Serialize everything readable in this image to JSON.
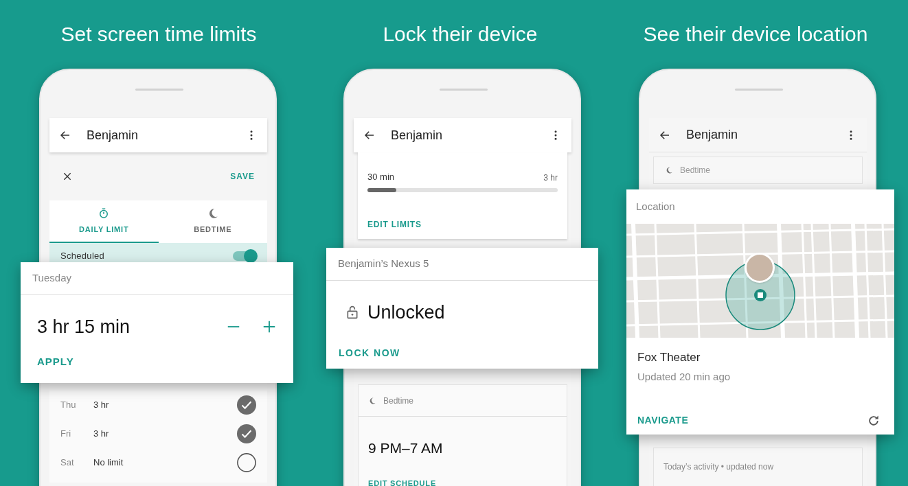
{
  "screen_time": {
    "heading": "Set screen time limits",
    "title": "Benjamin",
    "save": "SAVE",
    "tabs": [
      {
        "label": "DAILY LIMIT",
        "selected": true
      },
      {
        "label": "BEDTIME",
        "selected": false
      }
    ],
    "schedule": {
      "label": "Scheduled",
      "on": true
    },
    "days": [
      {
        "day": "Thu",
        "limit": "3 hr",
        "checked": true
      },
      {
        "day": "Fri",
        "limit": "3 hr",
        "checked": true
      },
      {
        "day": "Sat",
        "limit": "No limit",
        "checked": false
      }
    ],
    "card": {
      "title": "Tuesday",
      "value": "3 hr 15 min",
      "action": "APPLY"
    }
  },
  "lock": {
    "heading": "Lock their device",
    "title": "Benjamin",
    "usage": {
      "used": "30 min",
      "limit": "3 hr",
      "level": 0.15,
      "action": "EDIT LIMITS"
    },
    "card": {
      "title": "Benjamin’s Nexus 5",
      "status": "Unlocked",
      "action": "LOCK NOW"
    },
    "bedtime": {
      "title": "Bedtime",
      "time": "9 PM–7 AM",
      "action": "EDIT SCHEDULE"
    }
  },
  "location": {
    "heading": "See their device location",
    "title": "Benjamin",
    "bedtime": "Bedtime",
    "card": {
      "title": "Location",
      "place": "Fox Theater",
      "updated": "Updated 20 min ago",
      "action": "NAVIGATE"
    },
    "activity": "Today’s activity • updated now"
  }
}
